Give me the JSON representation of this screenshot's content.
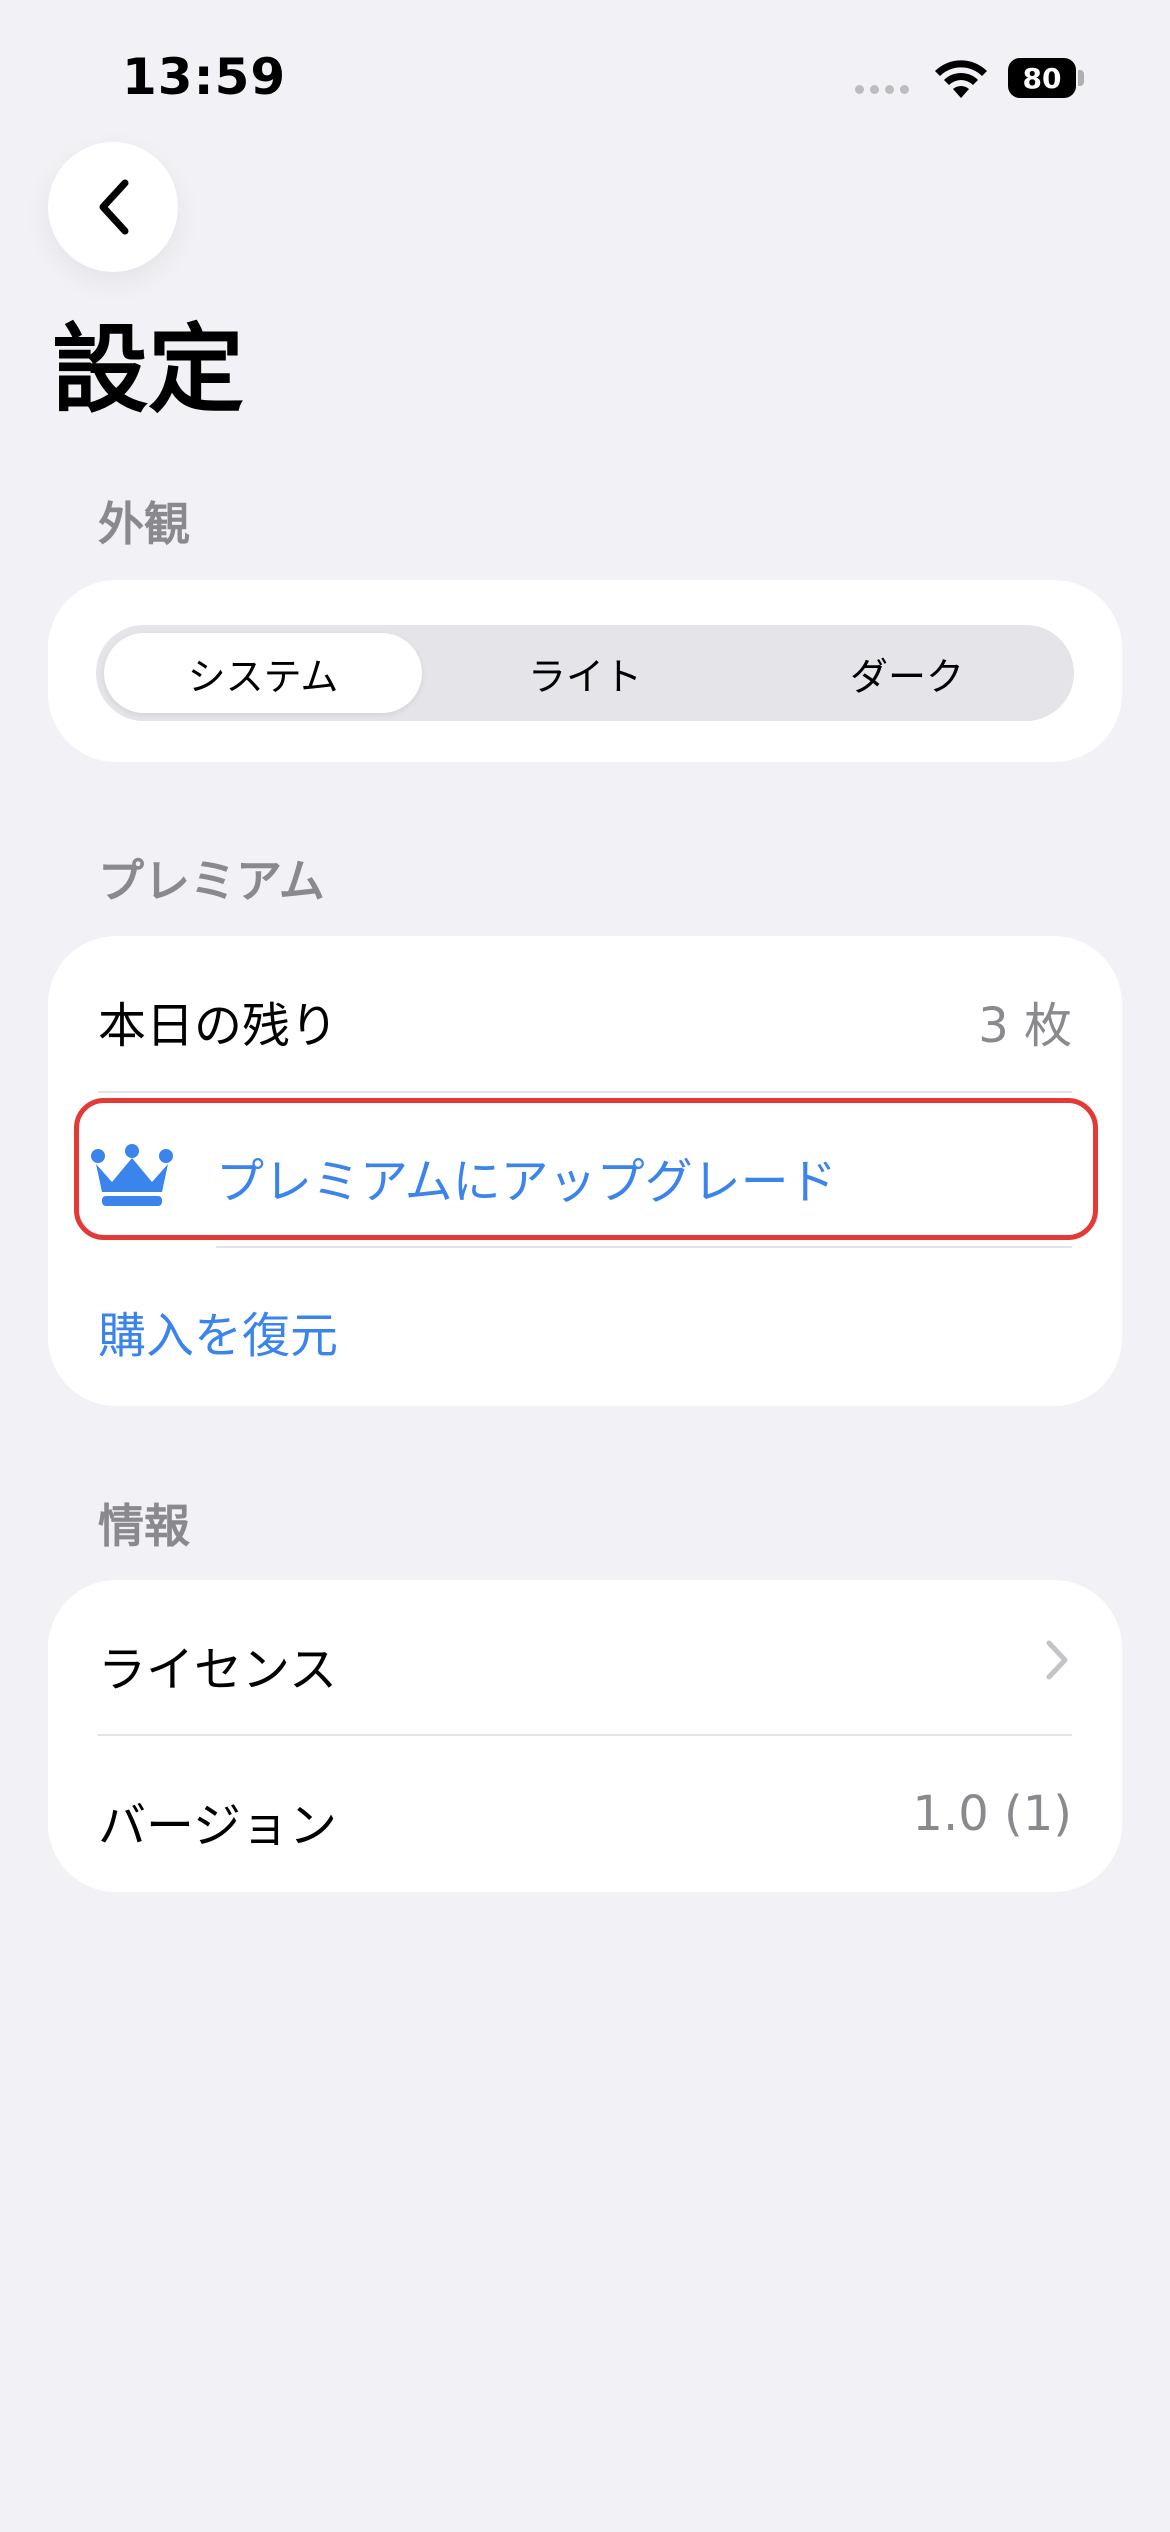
{
  "status_bar": {
    "time": "13:59",
    "battery": "80",
    "icons": [
      "signal-icon",
      "wifi-icon",
      "battery-icon"
    ]
  },
  "nav": {
    "back_icon": "chevron-left-icon"
  },
  "page": {
    "title": "設定"
  },
  "appearance": {
    "header": "外観",
    "options": [
      "システム",
      "ライト",
      "ダーク"
    ],
    "selected": "システム"
  },
  "premium": {
    "header": "プレミアム",
    "remaining_label": "本日の残り",
    "remaining_value": "3 枚",
    "upgrade_label": "プレミアムにアップグレード",
    "upgrade_icon": "crown-icon",
    "restore_label": "購入を復元"
  },
  "info": {
    "header": "情報",
    "license_label": "ライセンス",
    "license_icon": "chevron-right-icon",
    "version_label": "バージョン",
    "version_value": "1.0 (1)"
  },
  "colors": {
    "background": "#f1f1f6",
    "accent": "#3a84ec",
    "highlight": "#e53935",
    "secondary_text": "#8a8a8e"
  }
}
